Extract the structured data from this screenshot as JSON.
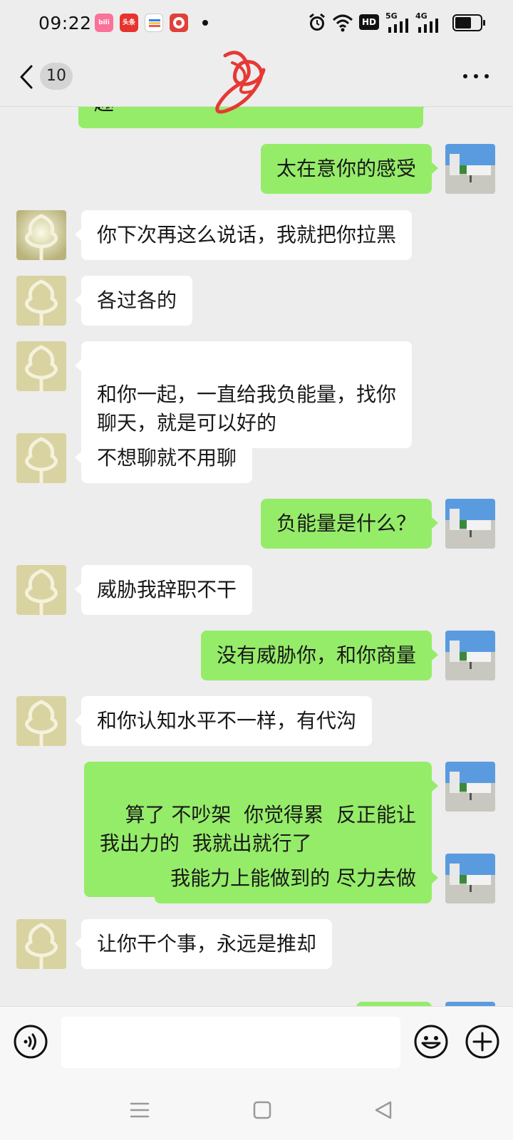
{
  "status_bar": {
    "time": "09:22",
    "app_icons": [
      {
        "name": "bilibili-icon",
        "label": "bili",
        "color": "#fb7299"
      },
      {
        "name": "toutiao-icon",
        "label": "头条",
        "color": "#e8322e"
      },
      {
        "name": "wallet-icon",
        "label": "",
        "color": "#ffffff"
      },
      {
        "name": "taobao-icon",
        "label": "",
        "color": "#e0403a"
      }
    ],
    "network_labels": {
      "hd": "HD",
      "sig1": "5G",
      "sig2": "4G"
    }
  },
  "header": {
    "unread_count": "10",
    "more_icon": "more-horizontal-icon"
  },
  "messages": [
    {
      "side": "out",
      "text": "趣",
      "avatar": "photo-avatar"
    },
    {
      "side": "out",
      "text": "太在意你的感受",
      "avatar": "photo-avatar"
    },
    {
      "side": "in",
      "text": "你下次再这么说话，我就把你拉黑",
      "avatar": "pearl-avatar"
    },
    {
      "side": "in",
      "text": "各过各的",
      "avatar": "pearl-avatar"
    },
    {
      "side": "in",
      "text": "和你一起，一直给我负能量，找你\n聊天，就是可以好的",
      "avatar": "pearl-avatar"
    },
    {
      "side": "in",
      "text": "不想聊就不用聊",
      "avatar": "pearl-avatar"
    },
    {
      "side": "out",
      "text": "负能量是什么？",
      "avatar": "photo-avatar"
    },
    {
      "side": "in",
      "text": "威胁我辞职不干",
      "avatar": "pearl-avatar"
    },
    {
      "side": "out",
      "text": "没有威胁你，和你商量",
      "avatar": "photo-avatar"
    },
    {
      "side": "in",
      "text": "和你认知水平不一样，有代沟",
      "avatar": "pearl-avatar"
    },
    {
      "side": "out",
      "text": "算了 不吵架  你觉得累  反正能让\n我出力的  我就出就行了",
      "avatar": "photo-avatar"
    },
    {
      "side": "out",
      "text": "我能力上能做到的 尽力去做",
      "avatar": "photo-avatar"
    },
    {
      "side": "in",
      "text": "让你干个事，永远是推却",
      "avatar": "pearl-avatar"
    }
  ],
  "input_bar": {
    "voice_icon": "voice-icon",
    "text_value": "",
    "emoji_icon": "emoji-icon",
    "plus_icon": "plus-icon"
  },
  "nav_bar": {
    "menu_icon": "menu-icon",
    "home_icon": "home-icon",
    "back_icon": "back-triangle-icon"
  },
  "colors": {
    "background": "#ededed",
    "outgoing_bubble": "#95ec69",
    "incoming_bubble": "#ffffff",
    "scribble": "#e53935"
  }
}
